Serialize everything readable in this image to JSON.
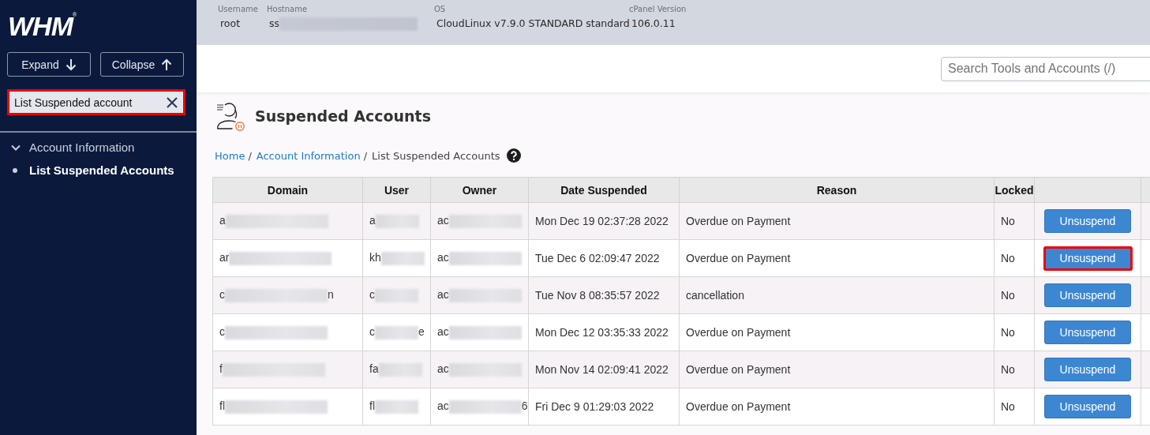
{
  "sidebar": {
    "logo": "WHM$^{®}$",
    "buttons": [
      {
        "label": "Expand",
        "kind": "expand"
      },
      {
        "label": "Collapse",
        "kind": "collapse"
      }
    ],
    "filter": {
      "value": "List Suspended account",
      "highlighted": true
    },
    "tree": [
      {
        "label": "Account Information",
        "expanded": true,
        "children": [
          {
            "label": "List Suspended Accounts",
            "selected": true
          }
        ]
      }
    ]
  },
  "server_info": [
    {
      "label": "Username",
      "value": {
        "text": "root"
      }
    },
    {
      "label": "Hostname",
      "value": {
        "text": "ss",
        "blur": true
      }
    },
    {
      "label": "OS",
      "value": {
        "text": "CloudLinux v7.9.0 STANDARD standard"
      }
    },
    {
      "label": "cPanel Version",
      "value": {
        "text": "106.0.11"
      }
    }
  ],
  "search": {
    "placeholder": "Search Tools and Accounts (/)"
  },
  "page": {
    "title": "Suspended Accounts",
    "breadcrumb": [
      {
        "label": "Home",
        "kind": "link",
        "separator": "/"
      },
      {
        "label": "Account Information",
        "kind": "link",
        "separator": "/"
      },
      {
        "label": "List Suspended Accounts",
        "kind": "current"
      }
    ]
  },
  "table": {
    "columns": [
      "Domain",
      "User",
      "Owner",
      "Date Suspended",
      "Reason",
      "Locked"
    ],
    "rows": [
      {
        "cells": [
          {
            "text": "a",
            "blur": true
          },
          {
            "text": "a",
            "blur": true
          },
          {
            "text": "ac",
            "blur": true
          },
          {
            "text": "Mon Dec 19 02:37:28 2022"
          },
          {
            "text": "Overdue on Payment"
          },
          {
            "text": "No"
          }
        ],
        "action": {
          "label": "Unsuspend",
          "highlighted": false
        }
      },
      {
        "cells": [
          {
            "text": "ar",
            "blur": true
          },
          {
            "text": "kh",
            "blur": true
          },
          {
            "text": "ac",
            "blur": true
          },
          {
            "text": "Tue Dec 6 02:09:47 2022"
          },
          {
            "text": "Overdue on Payment"
          },
          {
            "text": "No"
          }
        ],
        "action": {
          "label": "Unsuspend",
          "highlighted": true
        }
      },
      {
        "cells": [
          {
            "text": "c",
            "blur": true,
            "end": "n"
          },
          {
            "text": "c",
            "blur": true
          },
          {
            "text": "ac",
            "blur": true
          },
          {
            "text": "Tue Nov 8 08:35:57 2022"
          },
          {
            "text": "cancellation"
          },
          {
            "text": "No"
          }
        ],
        "action": {
          "label": "Unsuspend",
          "highlighted": false
        }
      },
      {
        "cells": [
          {
            "text": "c",
            "blur": true
          },
          {
            "text": "c",
            "blur": true,
            "end": "e"
          },
          {
            "text": "ac",
            "blur": true
          },
          {
            "text": "Mon Dec 12 03:35:33 2022"
          },
          {
            "text": "Overdue on Payment"
          },
          {
            "text": "No"
          }
        ],
        "action": {
          "label": "Unsuspend",
          "highlighted": false
        }
      },
      {
        "cells": [
          {
            "text": "f",
            "blur": true
          },
          {
            "text": "fa",
            "blur": true
          },
          {
            "text": "ac",
            "blur": true
          },
          {
            "text": "Mon Nov 14 02:09:41 2022"
          },
          {
            "text": "Overdue on Payment"
          },
          {
            "text": "No"
          }
        ],
        "action": {
          "label": "Unsuspend",
          "highlighted": false
        }
      },
      {
        "cells": [
          {
            "text": "fl",
            "blur": true
          },
          {
            "text": "fl",
            "blur": true
          },
          {
            "text": "ac",
            "blur": true,
            "end": "6"
          },
          {
            "text": "Fri Dec 9 01:29:03 2022"
          },
          {
            "text": "Overdue on Payment"
          },
          {
            "text": "No"
          }
        ],
        "action": {
          "label": "Unsuspend",
          "highlighted": false
        }
      }
    ]
  }
}
